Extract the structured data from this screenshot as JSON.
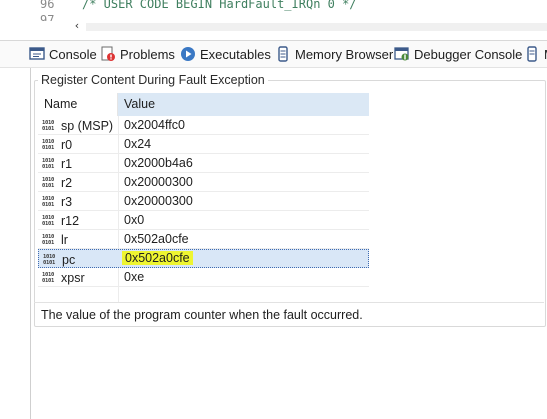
{
  "editor": {
    "line_numbers": [
      "96",
      "97"
    ],
    "code_text": "/* USER CODE BEGIN HardFault_IRQn 0 */"
  },
  "tabs": [
    {
      "label": "Console",
      "icon": "console-icon"
    },
    {
      "label": "Problems",
      "icon": "problems-icon"
    },
    {
      "label": "Executables",
      "icon": "executables-icon"
    },
    {
      "label": "Memory Browser",
      "icon": "memory-icon"
    },
    {
      "label": "Debugger Console",
      "icon": "debugger-console-icon"
    },
    {
      "label": "M",
      "icon": "memory-icon"
    }
  ],
  "fault_panel": {
    "group_title": "Register Content During Fault Exception",
    "columns": {
      "name": "Name",
      "value": "Value"
    },
    "rows": [
      {
        "name": "sp (MSP)",
        "value": "0x2004ffc0"
      },
      {
        "name": "r0",
        "value": "0x24"
      },
      {
        "name": "r1",
        "value": "0x2000b4a6"
      },
      {
        "name": "r2",
        "value": "0x20000300"
      },
      {
        "name": "r3",
        "value": "0x20000300"
      },
      {
        "name": "r12",
        "value": "0x0"
      },
      {
        "name": "lr",
        "value": "0x502a0cfe"
      },
      {
        "name": "pc",
        "value": "0x502a0cfe"
      },
      {
        "name": "xpsr",
        "value": "0xe"
      }
    ],
    "selected_row": "pc",
    "description": "The value of the program counter when the fault occurred."
  },
  "colors": {
    "selection": "#d9e7f7",
    "highlight": "#eef531",
    "header_value_bg": "#dbe8f5"
  }
}
